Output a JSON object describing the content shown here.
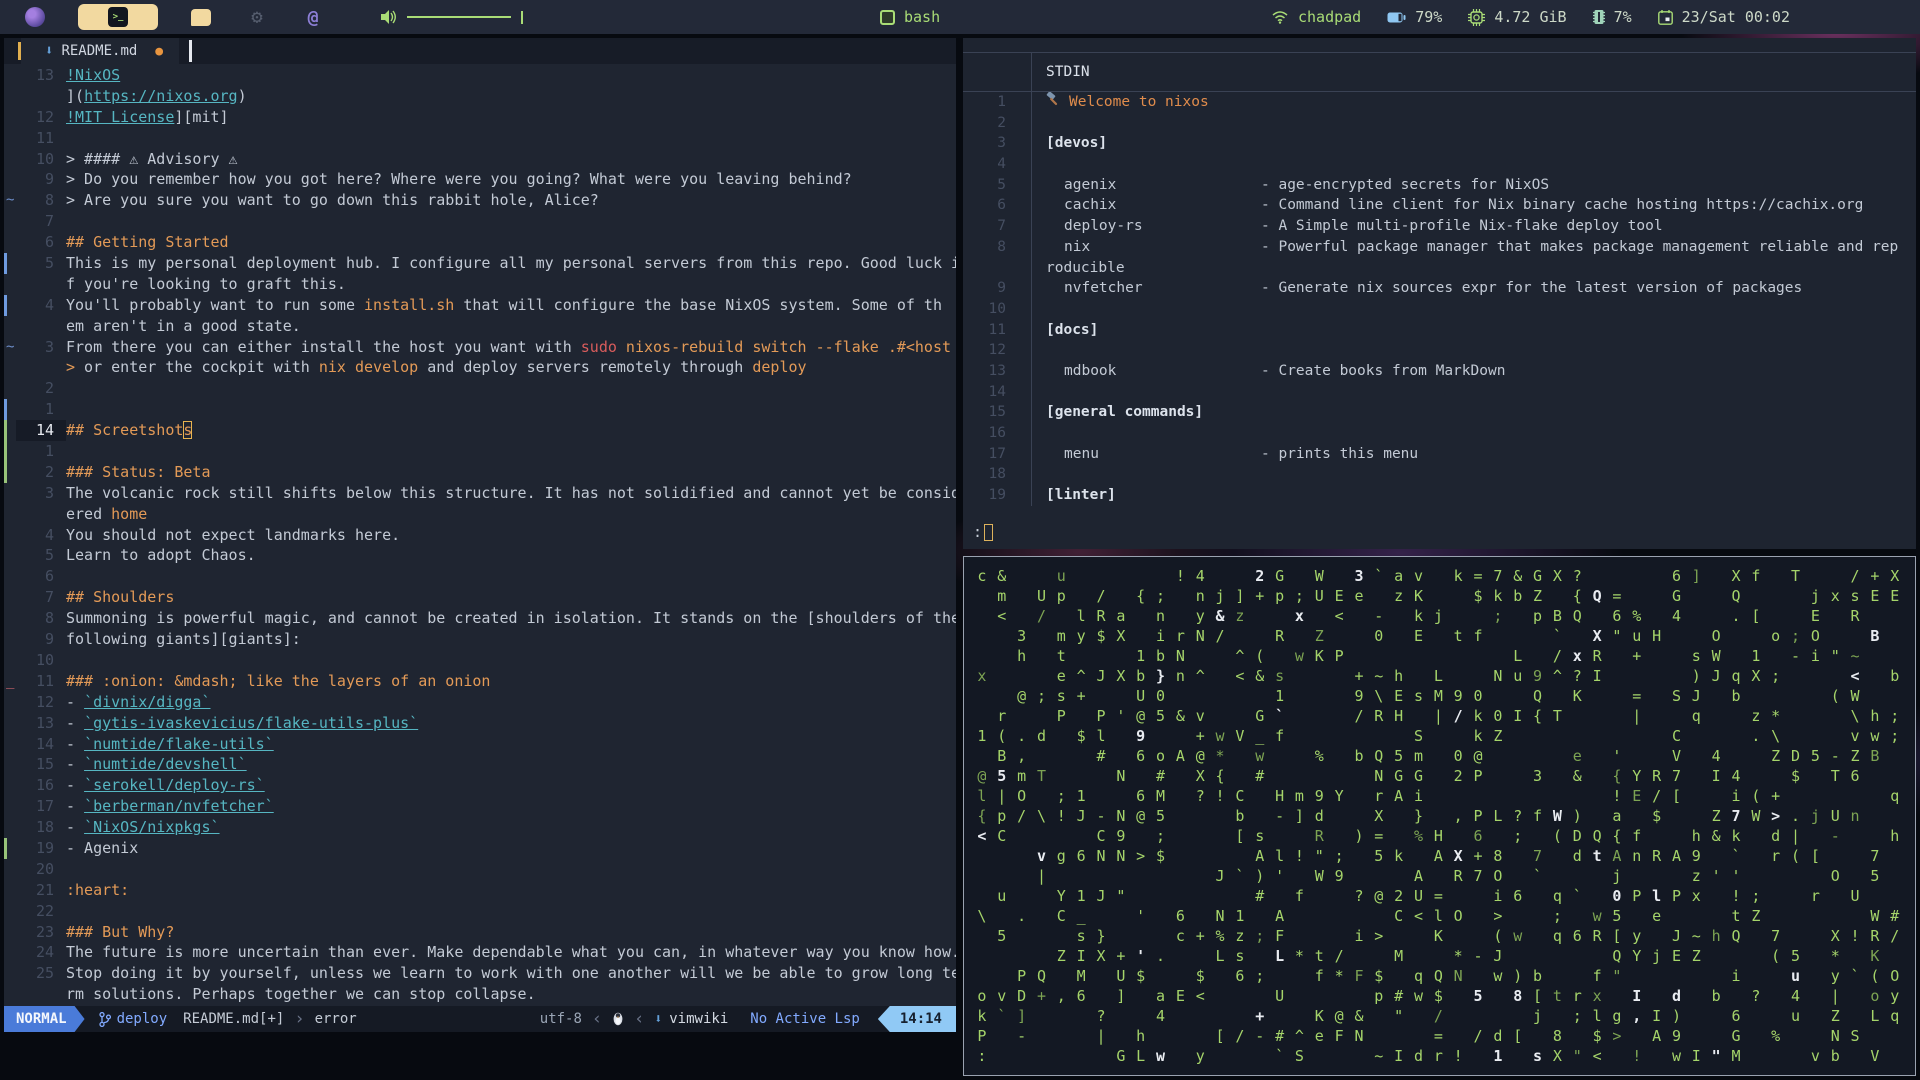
{
  "topbar": {
    "workspaces": [
      {
        "name": "firefox",
        "active": false
      },
      {
        "name": "terminal",
        "active": true
      },
      {
        "name": "chat",
        "active": false
      },
      {
        "name": "gear",
        "active": false
      },
      {
        "name": "at",
        "active": false
      }
    ],
    "terminal_glyph": ">_",
    "gear_glyph": "⚙",
    "at_glyph": "@",
    "window_title": "bash",
    "status": [
      {
        "icon": "wifi-icon",
        "text": "chadpad"
      },
      {
        "icon": "battery-icon",
        "text": "79%"
      },
      {
        "icon": "cpu-icon",
        "text": "4.72 GiB"
      },
      {
        "icon": "memory-icon",
        "text": "7%"
      },
      {
        "icon": "calendar-icon",
        "text": "23/Sat 00:02"
      }
    ],
    "colors": {
      "green": "#a9dc76",
      "blue": "#8fc7f2",
      "text": "#cdd9c8"
    }
  },
  "editor": {
    "tab": {
      "title": "README.md",
      "modified_dot": "●",
      "icon_glyph": "⬇"
    },
    "rows": [
      {
        "n": "13",
        "sign": "",
        "segs": [
          [
            "l",
            "!NixOS"
          ]
        ]
      },
      {
        "n": "",
        "sign": "",
        "segs": [
          [
            "t",
            "]("
          ],
          [
            "l",
            "https://nixos.org"
          ],
          [
            "t",
            ")"
          ]
        ]
      },
      {
        "n": "12",
        "sign": "",
        "segs": [
          [
            "l",
            "!MIT License"
          ],
          [
            "t",
            "][mit]"
          ]
        ]
      },
      {
        "n": "11",
        "sign": "",
        "segs": []
      },
      {
        "n": "10",
        "sign": "",
        "segs": [
          [
            "t",
            "> #### ⚠ Advisory ⚠"
          ]
        ]
      },
      {
        "n": "9",
        "sign": "",
        "segs": [
          [
            "t",
            "> Do you remember how you got here? Where were you going? What were you leaving behind?"
          ]
        ]
      },
      {
        "n": "8",
        "sign": "tilde",
        "segs": [
          [
            "t",
            "> Are you sure you want to go down this rabbit hole, Alice?"
          ]
        ]
      },
      {
        "n": "7",
        "sign": "",
        "segs": []
      },
      {
        "n": "6",
        "sign": "",
        "segs": [
          [
            "h",
            "## Getting Started"
          ]
        ]
      },
      {
        "n": "5",
        "sign": "bar-blue",
        "segs": [
          [
            "t",
            "This is my personal deployment hub. I configure all my personal servers from this repo. Good luck i"
          ]
        ]
      },
      {
        "n": "",
        "sign": "",
        "segs": [
          [
            "t",
            "f you're looking to graft this."
          ]
        ]
      },
      {
        "n": "4",
        "sign": "bar-blue",
        "segs": [
          [
            "t",
            "You'll probably want to run some "
          ],
          [
            "c",
            "install.sh"
          ],
          [
            "t",
            " that will configure the base NixOS system. Some of th"
          ]
        ]
      },
      {
        "n": "",
        "sign": "",
        "segs": [
          [
            "t",
            "em aren't in a good state."
          ]
        ]
      },
      {
        "n": "3",
        "sign": "tilde",
        "segs": [
          [
            "t",
            "From there you can either install the host you want with "
          ],
          [
            "r",
            "sudo"
          ],
          [
            "c",
            " nixos-rebuild switch --flake .#<host"
          ]
        ]
      },
      {
        "n": "",
        "sign": "",
        "segs": [
          [
            "c",
            ">"
          ],
          [
            "t",
            " or enter the cockpit with "
          ],
          [
            "c",
            "nix develop"
          ],
          [
            "t",
            " and deploy servers remotely through "
          ],
          [
            "c",
            "deploy"
          ]
        ]
      },
      {
        "n": "2",
        "sign": "",
        "segs": []
      },
      {
        "n": "1",
        "sign": "bar-blue",
        "segs": []
      },
      {
        "n": "14",
        "cur": true,
        "sign": "bar-green",
        "segs": [
          [
            "h",
            "## Screetshot"
          ],
          [
            "k",
            "s"
          ]
        ]
      },
      {
        "n": "1",
        "sign": "bar-green",
        "segs": []
      },
      {
        "n": "2",
        "sign": "bar-green",
        "segs": [
          [
            "h",
            "### Status: Beta"
          ]
        ]
      },
      {
        "n": "3",
        "sign": "",
        "segs": [
          [
            "t",
            "The volcanic rock still shifts below this structure. It has not solidified and cannot yet be consid"
          ]
        ]
      },
      {
        "n": "",
        "sign": "",
        "segs": [
          [
            "t",
            "ered "
          ],
          [
            "c",
            "home"
          ]
        ]
      },
      {
        "n": "4",
        "sign": "",
        "segs": [
          [
            "t",
            "You should not expect landmarks here."
          ]
        ]
      },
      {
        "n": "5",
        "sign": "",
        "segs": [
          [
            "t",
            "Learn to adopt Chaos."
          ]
        ]
      },
      {
        "n": "6",
        "sign": "",
        "segs": []
      },
      {
        "n": "7",
        "sign": "",
        "segs": [
          [
            "h",
            "## Shoulders"
          ]
        ]
      },
      {
        "n": "8",
        "sign": "",
        "segs": [
          [
            "t",
            "Summoning is powerful magic, and cannot be created in isolation. It stands on the [shoulders of the"
          ]
        ]
      },
      {
        "n": "9",
        "sign": "",
        "segs": [
          [
            "t",
            "following giants][giants]:"
          ]
        ]
      },
      {
        "n": "10",
        "sign": "",
        "segs": []
      },
      {
        "n": "11",
        "sign": "uline",
        "segs": [
          [
            "h",
            "### :onion: &mdash; like the layers of an onion"
          ]
        ]
      },
      {
        "n": "12",
        "sign": "",
        "segs": [
          [
            "t",
            "- "
          ],
          [
            "l",
            "`divnix/digga`"
          ]
        ]
      },
      {
        "n": "13",
        "sign": "",
        "segs": [
          [
            "t",
            "- "
          ],
          [
            "l",
            "`gytis-ivaskevicius/flake-utils-plus`"
          ]
        ]
      },
      {
        "n": "14",
        "sign": "",
        "segs": [
          [
            "t",
            "- "
          ],
          [
            "l",
            "`numtide/flake-utils`"
          ]
        ]
      },
      {
        "n": "15",
        "sign": "",
        "segs": [
          [
            "t",
            "- "
          ],
          [
            "l",
            "`numtide/devshell`"
          ]
        ]
      },
      {
        "n": "16",
        "sign": "",
        "segs": [
          [
            "t",
            "- "
          ],
          [
            "l",
            "`serokell/deploy-rs`"
          ]
        ]
      },
      {
        "n": "17",
        "sign": "",
        "segs": [
          [
            "t",
            "- "
          ],
          [
            "l",
            "`berberman/nvfetcher`"
          ]
        ]
      },
      {
        "n": "18",
        "sign": "",
        "segs": [
          [
            "t",
            "- "
          ],
          [
            "l",
            "`NixOS/nixpkgs`"
          ]
        ]
      },
      {
        "n": "19",
        "sign": "bar-green",
        "segs": [
          [
            "t",
            "- Agenix"
          ]
        ]
      },
      {
        "n": "20",
        "sign": "",
        "segs": []
      },
      {
        "n": "21",
        "sign": "",
        "segs": [
          [
            "h",
            ":heart:"
          ]
        ]
      },
      {
        "n": "22",
        "sign": "",
        "segs": []
      },
      {
        "n": "23",
        "sign": "",
        "segs": [
          [
            "h",
            "### But Why?"
          ]
        ]
      },
      {
        "n": "24",
        "sign": "",
        "segs": [
          [
            "t",
            "The future is more uncertain than ever. Make dependable what you can, in whatever way you know how."
          ]
        ]
      },
      {
        "n": "25",
        "sign": "",
        "segs": [
          [
            "t",
            "Stop doing it by yourself, unless we learn to work with one another will we be able to grow long te"
          ]
        ]
      },
      {
        "n": "",
        "sign": "",
        "segs": [
          [
            "t",
            "rm solutions. Perhaps together we can stop collapse."
          ]
        ]
      }
    ],
    "statusline": {
      "mode": "NORMAL",
      "git_branch": "deploy",
      "file": "README.md[+]",
      "sep_r": "›",
      "error": "error",
      "encoding": "utf-8",
      "sep_l": "‹",
      "filetype": "vimwiki",
      "filetype_icon": "⬇",
      "lsp": "No Active Lsp",
      "time": "14:14"
    }
  },
  "stdin_pane": {
    "title": "STDIN",
    "rows": [
      {
        "n": "1",
        "type": "welcome",
        "text": "Welcome to nixos"
      },
      {
        "n": "2",
        "type": "blank"
      },
      {
        "n": "3",
        "type": "section",
        "text": "[devos]"
      },
      {
        "n": "4",
        "type": "blank"
      },
      {
        "n": "5",
        "type": "pkg",
        "name": "agenix",
        "desc": "- age-encrypted secrets for NixOS"
      },
      {
        "n": "6",
        "type": "pkg",
        "name": "cachix",
        "desc": "- Command line client for Nix binary cache hosting https://cachix.org"
      },
      {
        "n": "7",
        "type": "pkg",
        "name": "deploy-rs",
        "desc": "- A Simple multi-profile Nix-flake deploy tool"
      },
      {
        "n": "8",
        "type": "pkg",
        "name": "nix",
        "desc": "- Powerful package manager that makes package management reliable and rep"
      },
      {
        "n": "",
        "type": "wrap",
        "text": "roducible"
      },
      {
        "n": "9",
        "type": "pkg",
        "name": "nvfetcher",
        "desc": "- Generate nix sources expr for the latest version of packages"
      },
      {
        "n": "10",
        "type": "blank"
      },
      {
        "n": "11",
        "type": "section",
        "text": "[docs]"
      },
      {
        "n": "12",
        "type": "blank"
      },
      {
        "n": "13",
        "type": "pkg",
        "name": "mdbook",
        "desc": "- Create books from MarkDown"
      },
      {
        "n": "14",
        "type": "blank"
      },
      {
        "n": "15",
        "type": "section",
        "text": "[general commands]"
      },
      {
        "n": "16",
        "type": "blank"
      },
      {
        "n": "17",
        "type": "pkg",
        "name": "menu",
        "desc": "- prints this menu"
      },
      {
        "n": "18",
        "type": "blank"
      },
      {
        "n": "19",
        "type": "section",
        "text": "[linter]"
      }
    ],
    "prompt": ":"
  },
  "matrix": {
    "seed": 20240223,
    "cols": 47,
    "rows": 25,
    "density": 0.52,
    "white_ratio": 0.06,
    "dim_ratio": 0.08,
    "charset": "!\"#$%&'()*+,-./0123456789:;<=>?@ABCDEFGHIJKLMNOPQRSTUVWXYZ[\\]^_`abcdefghijklmnopqrstuvwxyz{|}~",
    "color_green": "#a5d46a",
    "color_white": "#e9ecf1",
    "color_dim": "#7da453"
  }
}
